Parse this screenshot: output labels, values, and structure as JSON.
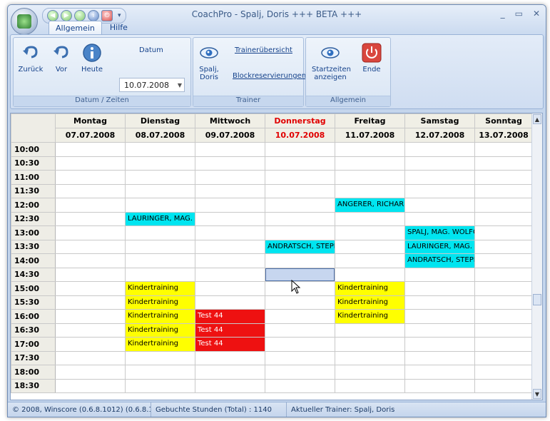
{
  "window": {
    "title": "CoachPro - Spalj, Doris +++ BETA +++"
  },
  "ribbon": {
    "tabs": [
      {
        "label": "Allgemein"
      },
      {
        "label": "Hilfe"
      }
    ],
    "groups": [
      {
        "label": "Datum / Zeiten",
        "buttons": [
          {
            "label": "Zurück"
          },
          {
            "label": "Vor"
          },
          {
            "label": "Heute"
          }
        ],
        "date_label": "Datum",
        "date_value": "10.07.2008"
      },
      {
        "label": "Trainer",
        "trainer_name": "Spalj, Doris",
        "links": [
          {
            "label": "Trainerübersicht"
          },
          {
            "label": "Blockreservierungen"
          }
        ]
      },
      {
        "label": "Allgemein",
        "buttons": [
          {
            "label": "Startzeiten anzeigen"
          },
          {
            "label": "Ende"
          }
        ]
      }
    ]
  },
  "calendar": {
    "days": [
      {
        "name": "Montag",
        "date": "07.07.2008"
      },
      {
        "name": "Dienstag",
        "date": "08.07.2008"
      },
      {
        "name": "Mittwoch",
        "date": "09.07.2008"
      },
      {
        "name": "Donnerstag",
        "date": "10.07.2008"
      },
      {
        "name": "Freitag",
        "date": "11.07.2008"
      },
      {
        "name": "Samstag",
        "date": "12.07.2008"
      },
      {
        "name": "Sonntag",
        "date": "13.07.2008"
      }
    ],
    "today_index": 3,
    "times": [
      "10:00",
      "10:30",
      "11:00",
      "11:30",
      "12:00",
      "12:30",
      "13:00",
      "13:30",
      "14:00",
      "14:30",
      "15:00",
      "15:30",
      "16:00",
      "16:30",
      "17:00",
      "17:30",
      "18:00",
      "18:30"
    ],
    "events": [
      {
        "day": 4,
        "time": "12:00",
        "label": "ANGERER, RICHARD",
        "color": "cyan"
      },
      {
        "day": 1,
        "time": "12:30",
        "label": "LAURINGER, MAG. P",
        "color": "cyan"
      },
      {
        "day": 5,
        "time": "13:00",
        "label": "SPALJ, MAG. WOLFG",
        "color": "cyan"
      },
      {
        "day": 3,
        "time": "13:30",
        "label": "ANDRATSCH, STEPH",
        "color": "cyan"
      },
      {
        "day": 5,
        "time": "13:30",
        "label": "LAURINGER, MAG. P",
        "color": "cyan"
      },
      {
        "day": 5,
        "time": "14:00",
        "label": "ANDRATSCH, STEPH",
        "color": "cyan"
      },
      {
        "day": 3,
        "time": "14:30",
        "label": "",
        "color": "sel"
      },
      {
        "day": 1,
        "time": "15:00",
        "label": "Kindertraining",
        "color": "yellow"
      },
      {
        "day": 4,
        "time": "15:00",
        "label": "Kindertraining",
        "color": "yellow"
      },
      {
        "day": 1,
        "time": "15:30",
        "label": "Kindertraining",
        "color": "yellow"
      },
      {
        "day": 4,
        "time": "15:30",
        "label": "Kindertraining",
        "color": "yellow"
      },
      {
        "day": 1,
        "time": "16:00",
        "label": "Kindertraining",
        "color": "yellow"
      },
      {
        "day": 2,
        "time": "16:00",
        "label": "Test 44",
        "color": "red"
      },
      {
        "day": 4,
        "time": "16:00",
        "label": "Kindertraining",
        "color": "yellow"
      },
      {
        "day": 1,
        "time": "16:30",
        "label": "Kindertraining",
        "color": "yellow"
      },
      {
        "day": 2,
        "time": "16:30",
        "label": "Test 44",
        "color": "red"
      },
      {
        "day": 1,
        "time": "17:00",
        "label": "Kindertraining",
        "color": "yellow"
      },
      {
        "day": 2,
        "time": "17:00",
        "label": "Test 44",
        "color": "red"
      }
    ]
  },
  "status": {
    "copyright": "© 2008, Winscore  (0.6.8.1012)  (0.6.8.1",
    "hours": "Gebuchte Stunden (Total) : 1140",
    "trainer": "Aktueller Trainer: Spalj, Doris"
  },
  "colors": {
    "cyan": "#00e5f0",
    "yellow": "#ffff00",
    "red": "#ee1111",
    "today": "#e00000"
  }
}
